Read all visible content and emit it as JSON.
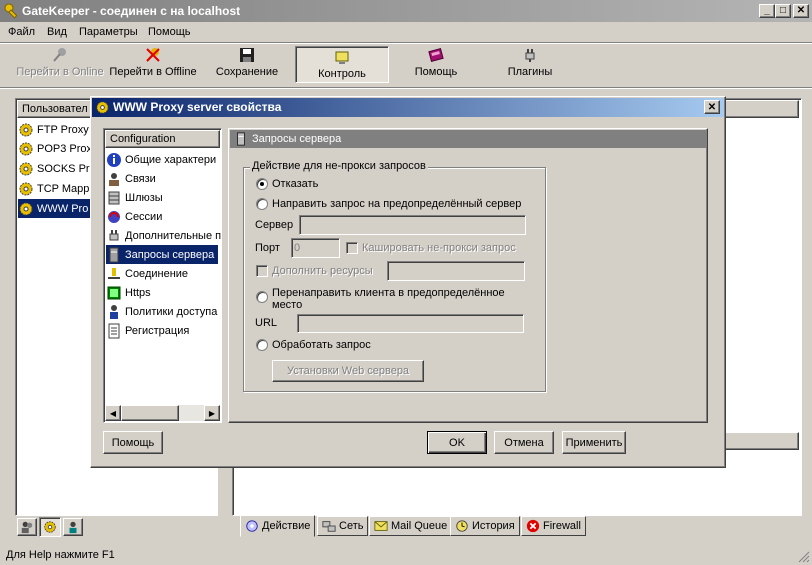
{
  "app": {
    "title": "GateKeeper - соединен с на localhost"
  },
  "window_controls": {
    "minimize": "_",
    "maximize": "□",
    "close": "✕"
  },
  "menu": [
    "Файл",
    "Вид",
    "Параметры",
    "Помощь"
  ],
  "toolbar": [
    {
      "label": "Перейти в Online",
      "icon": "key-icon",
      "disabled": true
    },
    {
      "label": "Перейти в Offline",
      "icon": "key-cross-icon",
      "disabled": false
    },
    {
      "label": "Сохранение",
      "icon": "floppy-icon",
      "disabled": false
    },
    {
      "label": "Контроль",
      "icon": "monitor-icon",
      "disabled": false,
      "pressed": true
    },
    {
      "label": "Помощь",
      "icon": "help-book-icon",
      "disabled": false
    },
    {
      "label": "Плагины",
      "icon": "plug-icon",
      "disabled": false
    }
  ],
  "left_panel": {
    "header": "Пользовател",
    "items": [
      "FTP Proxy",
      "POP3 Prox",
      "SOCKS Pr",
      "TCP Mapp",
      "WWW Pro"
    ],
    "selected_index": 4
  },
  "dialog": {
    "title": "WWW Proxy server свойства",
    "close": "✕",
    "tree": {
      "header": "Configuration",
      "items": [
        {
          "label": "Общие характери",
          "icon": "info-icon"
        },
        {
          "label": "Связи",
          "icon": "users-icon"
        },
        {
          "label": "Шлюзы",
          "icon": "gateway-icon"
        },
        {
          "label": "Сессии",
          "icon": "sessions-icon"
        },
        {
          "label": "Дополнительные п",
          "icon": "plug-icon"
        },
        {
          "label": "Запросы сервера",
          "icon": "server-icon"
        },
        {
          "label": "Соединение",
          "icon": "connection-icon"
        },
        {
          "label": "Https",
          "icon": "https-icon"
        },
        {
          "label": "Политики доступа",
          "icon": "policy-icon"
        },
        {
          "label": "Регистрация",
          "icon": "log-icon"
        }
      ],
      "selected_index": 5,
      "scroll_left": "◀",
      "scroll_right": "▶"
    },
    "panel_title": "Запросы сервера",
    "group_label": "Действие для не-прокси запросов",
    "options": {
      "refuse": "Отказать",
      "redirect_request": "Направить запрос на предопределённый сервер",
      "server_label": "Сервер",
      "server_value": "",
      "port_label": "Порт",
      "port_value": "0",
      "cache_label": "Кашировать не-прокси запрос",
      "append_label": "Дополнить ресурсы",
      "append_value": "",
      "redirect_client": "Перенаправить клиента в предопределённое место",
      "url_label": "URL",
      "url_value": "",
      "process": "Обработать запрос",
      "web_settings": "Установки Web сервера"
    },
    "buttons": {
      "help": "Помощь",
      "ok": "OK",
      "cancel": "Отмена",
      "apply": "Применить"
    }
  },
  "bottom_tabs": [
    {
      "label": "Действие",
      "icon": "action-icon"
    },
    {
      "label": "Сеть",
      "icon": "network-icon"
    },
    {
      "label": "Mail Queue",
      "icon": "mail-icon"
    },
    {
      "label": "История",
      "icon": "clock-icon"
    },
    {
      "label": "Firewall",
      "icon": "firewall-icon"
    }
  ],
  "status": {
    "text": "Для Help нажмите F1"
  }
}
